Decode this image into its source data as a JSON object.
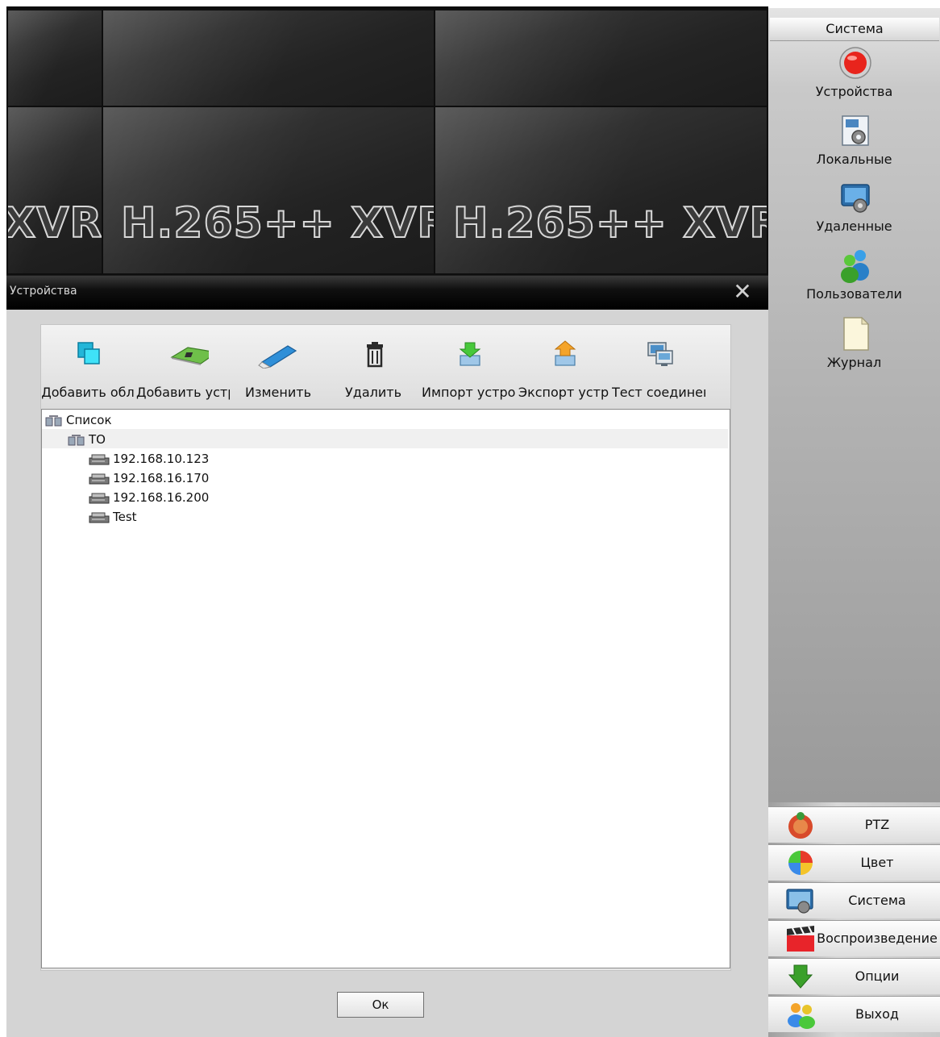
{
  "video_wall": {
    "brand_text": "H.265++ XVR",
    "brand_partial": "XVR"
  },
  "dialog": {
    "title": "Устройства",
    "close_glyph": "✕",
    "toolbar": [
      {
        "id": "add-area",
        "label": "Добавить обл",
        "icon": "add-area-icon"
      },
      {
        "id": "add-device",
        "label": "Добавить устр",
        "icon": "add-device-icon"
      },
      {
        "id": "edit",
        "label": "Изменить",
        "icon": "edit-icon"
      },
      {
        "id": "delete",
        "label": "Удалить",
        "icon": "trash-icon"
      },
      {
        "id": "import",
        "label": "Импорт устро",
        "icon": "import-icon"
      },
      {
        "id": "export",
        "label": "Экспорт устр",
        "icon": "export-icon"
      },
      {
        "id": "test",
        "label": "Тест соединени",
        "icon": "test-connection-icon"
      }
    ],
    "tree": {
      "root": "Список",
      "group": "ТО",
      "devices": [
        "192.168.10.123",
        "192.168.16.170",
        "192.168.16.200",
        "Test"
      ]
    },
    "ok_label": "Ок"
  },
  "sidebar": {
    "header": "Система",
    "items": [
      {
        "label": "Устройства",
        "icon": "red-record-icon"
      },
      {
        "label": "Локальные",
        "icon": "local-settings-icon"
      },
      {
        "label": "Удаленные",
        "icon": "remote-settings-icon"
      },
      {
        "label": "Пользователи",
        "icon": "users-icon"
      },
      {
        "label": "Журнал",
        "icon": "log-document-icon"
      }
    ],
    "buttons": [
      {
        "label": "PTZ",
        "icon": "ptz-icon"
      },
      {
        "label": "Цвет",
        "icon": "color-icon"
      },
      {
        "label": "Система",
        "icon": "system-icon"
      },
      {
        "label": "Воспроизведение",
        "icon": "playback-icon"
      },
      {
        "label": "Опции",
        "icon": "options-icon"
      },
      {
        "label": "Выход",
        "icon": "exit-icon"
      }
    ]
  },
  "colors": {
    "dialog_bg": "#d4d4d4",
    "titlebar": "#000000",
    "record_red": "#e8241c",
    "tool_cyan": "#1ec8e8"
  }
}
